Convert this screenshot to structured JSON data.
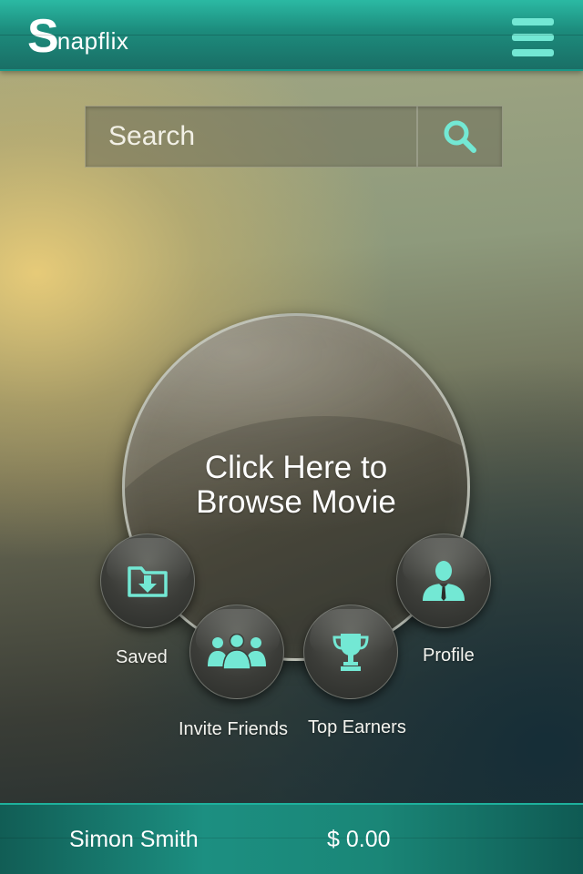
{
  "header": {
    "logo_initial": "S",
    "logo_rest": "napflix"
  },
  "search": {
    "placeholder": "Search"
  },
  "main": {
    "browse_line1": "Click Here to",
    "browse_line2": "Browse Movie"
  },
  "actions": [
    {
      "label": "Saved",
      "icon": "download-folder-icon"
    },
    {
      "label": "Invite Friends",
      "icon": "group-icon"
    },
    {
      "label": "Top Earners",
      "icon": "trophy-icon"
    },
    {
      "label": "Profile",
      "icon": "user-icon"
    }
  ],
  "footer": {
    "user_name": "Simon Smith",
    "balance": "$ 0.00"
  },
  "colors": {
    "accent": "#73e8d4",
    "header_teal": "#1c8b7c"
  }
}
